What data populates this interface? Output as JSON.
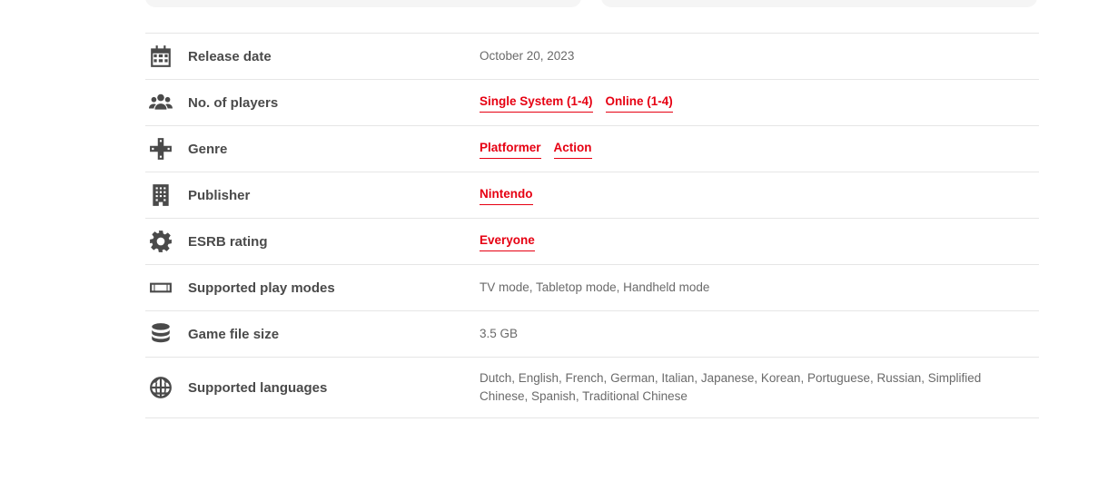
{
  "specs": {
    "release_date": {
      "label": "Release date",
      "value": "October 20, 2023",
      "icon": "calendar-icon"
    },
    "players": {
      "label": "No. of players",
      "links": [
        "Single System (1-4)",
        "Online (1-4)"
      ],
      "icon": "players-icon"
    },
    "genre": {
      "label": "Genre",
      "links": [
        "Platformer",
        "Action"
      ],
      "icon": "dpad-icon"
    },
    "publisher": {
      "label": "Publisher",
      "links": [
        "Nintendo"
      ],
      "icon": "building-icon"
    },
    "esrb": {
      "label": "ESRB rating",
      "links": [
        "Everyone"
      ],
      "icon": "gear-icon"
    },
    "play_modes": {
      "label": "Supported play modes",
      "value": "TV mode, Tabletop mode, Handheld mode",
      "icon": "switch-console-icon"
    },
    "file_size": {
      "label": "Game file size",
      "value": "3.5 GB",
      "icon": "database-icon"
    },
    "languages": {
      "label": "Supported languages",
      "value": "Dutch, English, French, German, Italian, Japanese, Korean, Portuguese, Russian, Simplified Chinese, Spanish, Traditional Chinese",
      "icon": "globe-icon"
    }
  },
  "colors": {
    "accent": "#e60012",
    "label": "#4a4a4a",
    "value": "#6a6a6a",
    "divider": "#e6e6e6"
  }
}
